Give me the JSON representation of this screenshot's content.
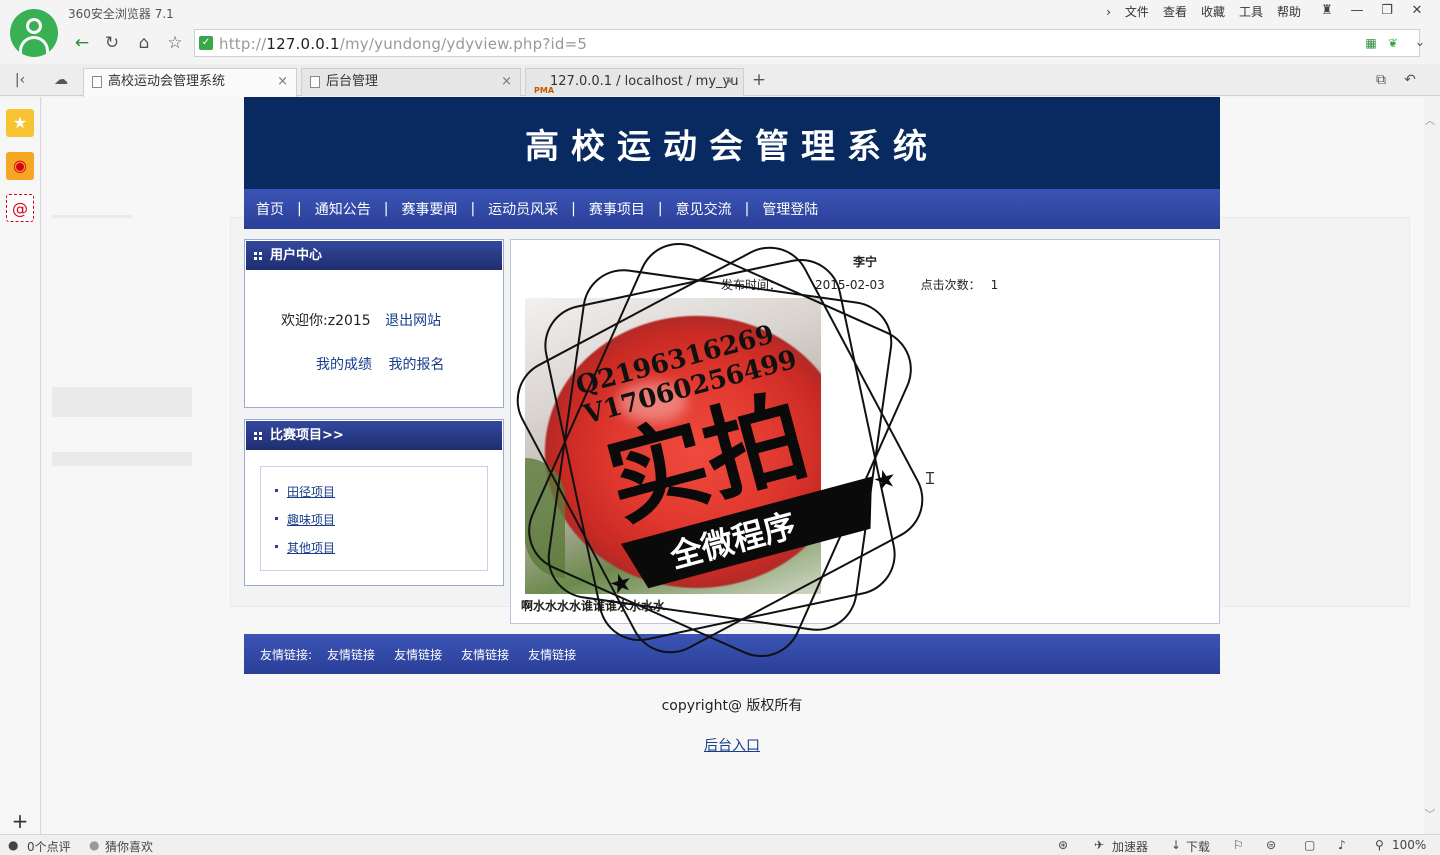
{
  "browser": {
    "app_title": "360安全浏览器 7.1",
    "menu": [
      "文件",
      "查看",
      "收藏",
      "工具",
      "帮助"
    ],
    "url_prefix": "http://",
    "url_host": "127.0.0.1",
    "url_path": "/my/yundong/ydyview.php?id=5",
    "tabs": [
      {
        "label": "高校运动会管理系统",
        "active": true
      },
      {
        "label": "后台管理",
        "active": false
      },
      {
        "label": "127.0.0.1 / localhost / my_yu",
        "active": false
      }
    ],
    "status": {
      "comments": "0个点评",
      "guess": "猜你喜欢",
      "accelerator": "加速器",
      "download": "下载",
      "zoom": "100%"
    }
  },
  "site": {
    "title": "高校运动会管理系统",
    "nav": [
      "首页",
      "通知公告",
      "赛事要闻",
      "运动员风采",
      "赛事项目",
      "意见交流",
      "管理登陆"
    ],
    "user_center": {
      "heading": "用户中心",
      "welcome": "欢迎你:z2015",
      "logout": "退出网站",
      "my_scores": "我的成绩",
      "my_signup": "我的报名"
    },
    "events": {
      "heading": "比赛项目>>",
      "items": [
        "田径项目",
        "趣味项目",
        "其他项目"
      ]
    },
    "article": {
      "author": "李宁",
      "time_label": "发布时间：",
      "time_value": "2015-02-03",
      "clicks_label": "点击次数：",
      "clicks_value": "1",
      "caption": "啊水水水水谁谁谁水水水水"
    },
    "watermark": {
      "line1": "Q2196316269",
      "line2": "V17060256499",
      "big": "实拍",
      "ribbon": "全微程序"
    },
    "footer": {
      "links_label": "友情链接:",
      "links": [
        "友情链接",
        "友情链接",
        "友情链接",
        "友情链接"
      ],
      "copyright": "copyright@ 版权所有",
      "admin_entry": "后台入口"
    }
  }
}
